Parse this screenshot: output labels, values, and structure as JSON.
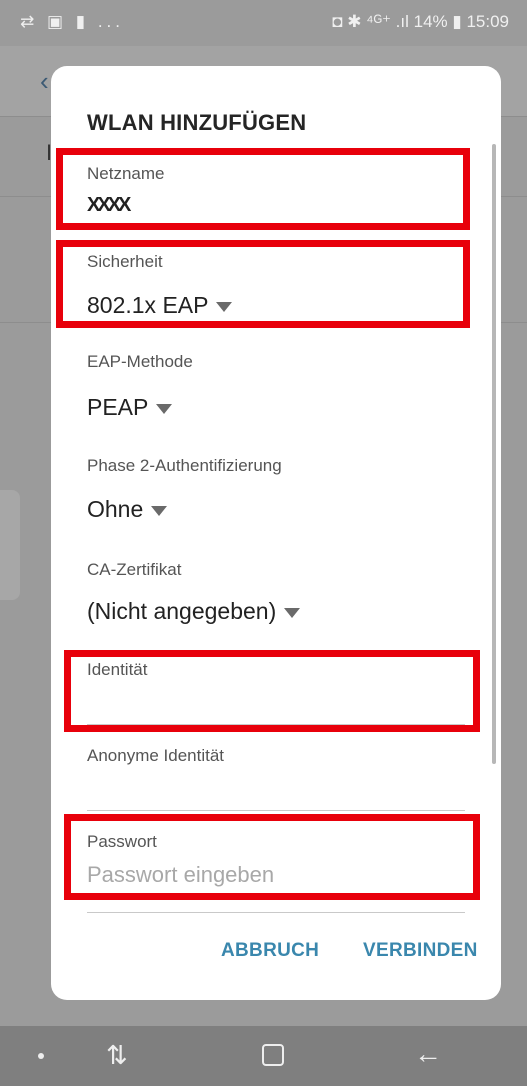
{
  "status_bar": {
    "left_icons": "⇄ ▣ ▮ ...",
    "right_text": "◘ ✱ ⁴ᴳ⁺ .ıl 14% ▮ 15:09"
  },
  "dialog": {
    "title": "WLAN HINZUFÜGEN",
    "network_name": {
      "label": "Netzname",
      "value": "XXXX"
    },
    "security": {
      "label": "Sicherheit",
      "value": "802.1x EAP"
    },
    "eap_method": {
      "label": "EAP-Methode",
      "value": "PEAP"
    },
    "phase2": {
      "label": "Phase 2-Authentifizierung",
      "value": "Ohne"
    },
    "ca_certificate": {
      "label": "CA-Zertifikat",
      "value": "(Nicht angegeben)"
    },
    "identity": {
      "label": "Identität",
      "value": ""
    },
    "anonymous_identity": {
      "label": "Anonyme Identität",
      "value": ""
    },
    "password": {
      "label": "Passwort",
      "placeholder": "Passwort eingeben"
    },
    "buttons": {
      "cancel": "ABBRUCH",
      "connect": "VERBINDEN"
    }
  },
  "background_app": {
    "back_icon": "back-arrow-icon",
    "partial_letter": "I"
  },
  "nav_bar": {
    "icons": [
      "dot-icon",
      "recent-apps-icon",
      "home-icon",
      "back-icon"
    ]
  },
  "colors": {
    "accent": "#3a87ad",
    "annotation": "#e8000b"
  }
}
